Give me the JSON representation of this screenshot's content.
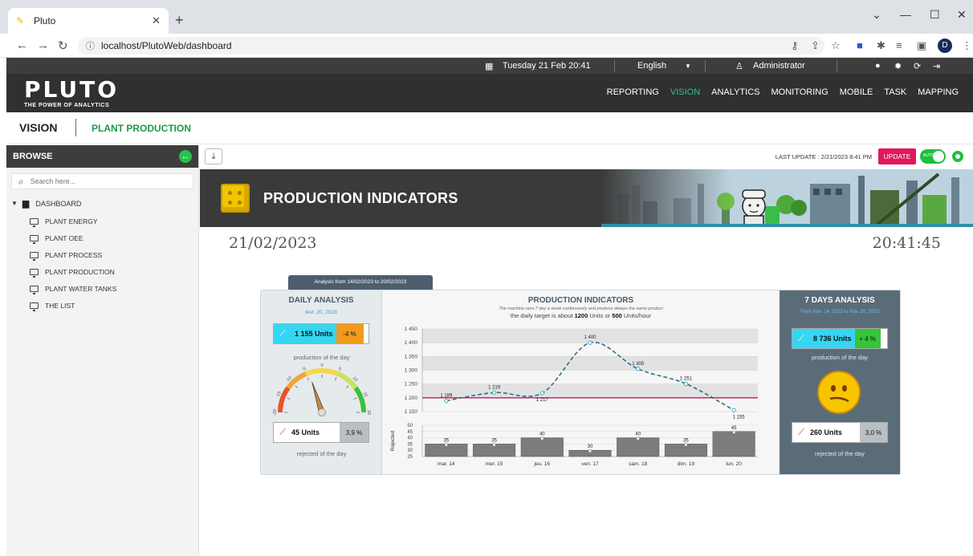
{
  "browser": {
    "tab_title": "Pluto",
    "url": "localhost/PlutoWeb/dashboard",
    "profile_initial": "D"
  },
  "topstrip": {
    "datetime": "Tuesday 21 Feb 20:41",
    "language": "English",
    "user": "Administrator"
  },
  "header": {
    "logo": "PLUTO",
    "tagline": "THE POWER OF ANALYTICS",
    "nav": [
      "REPORTING",
      "VISION",
      "ANALYTICS",
      "MONITORING",
      "MOBILE",
      "TASK",
      "MAPPING"
    ],
    "active_nav": "VISION"
  },
  "breadcrumb": {
    "section": "VISION",
    "page": "PLANT PRODUCTION"
  },
  "sidebar": {
    "title": "BROWSE",
    "search_placeholder": "Search here...",
    "root": "DASHBOARD",
    "items": [
      "PLANT ENERGY",
      "PLANT OEE",
      "PLANT PROCESS",
      "PLANT PRODUCTION",
      "PLANT WATER TANKS",
      "THE LIST"
    ]
  },
  "toolbar": {
    "last_update": "LAST UPDATE : 2/21/2023 8:41 PM",
    "update_label": "UPDATE",
    "toggle_label": "AUTO"
  },
  "banner": {
    "title": "PRODUCTION INDICATORS"
  },
  "dashboard": {
    "date": "21/02/2023",
    "time": "20:41:45",
    "period_tab": "Analysis from 14/02/2023 to 20/02/2023",
    "daily": {
      "title": "DAILY ANALYSIS",
      "date": "févr. 20, 2023",
      "production_value": "1 155 Units",
      "production_pct": "-4 %",
      "production_caption": "production of the day",
      "gauge_ticks": [
        "-20",
        "-15",
        "-10",
        "-5",
        "0",
        "5",
        "10",
        "15",
        "20"
      ],
      "gauge_value": -4,
      "rejected_value": "45 Units",
      "rejected_pct": "3,9 %",
      "rejected_caption": "rejected of the day"
    },
    "center": {
      "title": "PRODUCTION INDICATORS",
      "note": "The machine runs 7 day a week continuously and produce always the same product",
      "target_prefix": "the daily target is about",
      "target_daily": "1200",
      "target_mid": "Units or",
      "target_hourly": "500",
      "target_suffix": "Units/hour"
    },
    "weekly": {
      "title": "7 DAYS ANALYSIS",
      "range": "From Nov. 14, 2023 to Nov. 20, 2023",
      "production_value": "8 736 Units",
      "production_pct": "+ 4 %",
      "production_caption": "production of the day",
      "rejected_value": "260 Units",
      "rejected_pct": "3,0 %",
      "rejected_caption": "rejected of the day"
    },
    "colors": {
      "target_line": "#c2185b",
      "production_line": "#2f6f86",
      "bad_pct": "#f29a1d",
      "good_pct": "#35c43a",
      "kpi_cyan": "#35d6f2"
    }
  },
  "chart_data": [
    {
      "type": "line",
      "categories": [
        "mar. 14",
        "mer. 15",
        "jeu. 16",
        "ven. 17",
        "sam. 18",
        "dim. 19",
        "lun. 20"
      ],
      "series": [
        {
          "values": [
            1189,
            1219,
            1217,
            1400,
            1305,
            1251,
            1155
          ]
        }
      ],
      "target": 1200,
      "ylim": [
        1150,
        1450
      ],
      "yticks": [
        "1 150",
        "1 200",
        "1 250",
        "1 300",
        "1 350",
        "1 400",
        "1 450"
      ],
      "labels": [
        "1 189",
        "1 219",
        "1 217",
        "1 400",
        "1 305",
        "1 251",
        "1 155"
      ]
    },
    {
      "type": "bar",
      "categories": [
        "mar. 14",
        "mer. 15",
        "jeu. 16",
        "ven. 17",
        "sam. 18",
        "dim. 19",
        "lun. 20"
      ],
      "values": [
        35,
        35,
        40,
        30,
        40,
        35,
        45
      ],
      "ylabel": "Rejected",
      "ylim": [
        25,
        50
      ],
      "yticks": [
        "25",
        "30",
        "35",
        "40",
        "45",
        "50"
      ]
    }
  ]
}
